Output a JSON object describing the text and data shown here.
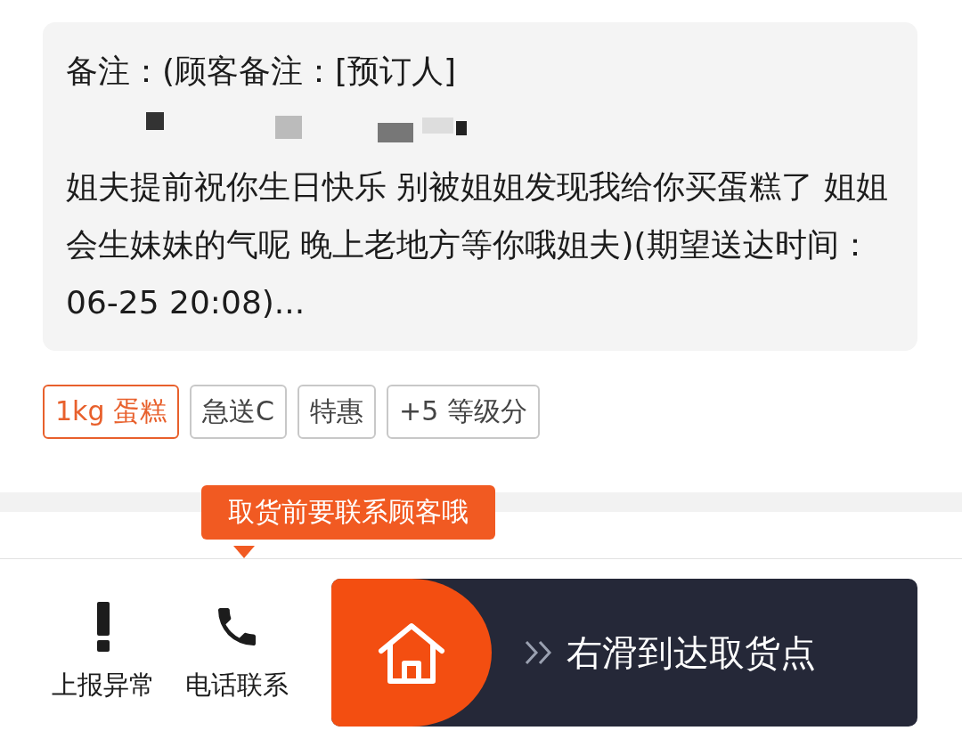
{
  "note": {
    "before": "备注：(顾客备注：[预订人]",
    "after": "姐夫提前祝你生日快乐 别被姐姐发现我给你买蛋糕了 姐姐会生妹妹的气呢 晚上老地方等你哦姐夫)(期望送达时间：06-25 20:08)..."
  },
  "tags": [
    {
      "label": "1kg 蛋糕",
      "highlight": true
    },
    {
      "label": "急送C",
      "highlight": false
    },
    {
      "label": "特惠",
      "highlight": false
    },
    {
      "label": "+5 等级分",
      "highlight": false
    }
  ],
  "tooltip": "取货前要联系顾客哦",
  "actions": [
    {
      "kind": "report",
      "label": "上报异常"
    },
    {
      "kind": "phone",
      "label": "电话联系"
    }
  ],
  "slider": {
    "label": "右滑到达取货点"
  }
}
